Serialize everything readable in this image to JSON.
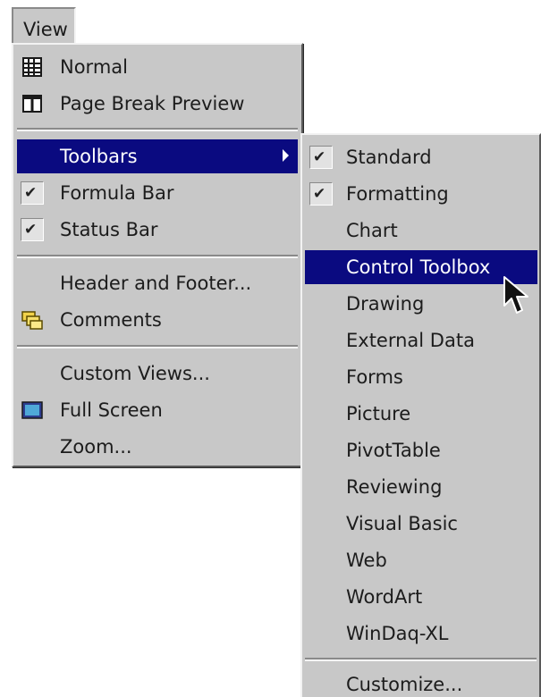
{
  "menubar": {
    "view_label": "View"
  },
  "view_menu": {
    "items": [
      {
        "label": "Normal",
        "icon": "normal-view-icon"
      },
      {
        "label": "Page Break Preview",
        "icon": "page-break-preview-icon"
      },
      {
        "label": "Toolbars",
        "highlighted": true,
        "has_submenu": true
      },
      {
        "label": "Formula Bar",
        "checked": true
      },
      {
        "label": "Status Bar",
        "checked": true
      },
      {
        "label": "Header and Footer..."
      },
      {
        "label": "Comments",
        "icon": "comments-icon"
      },
      {
        "label": "Custom Views..."
      },
      {
        "label": "Full Screen",
        "icon": "full-screen-icon"
      },
      {
        "label": "Zoom..."
      }
    ]
  },
  "toolbars_submenu": {
    "items": [
      {
        "label": "Standard",
        "checked": true
      },
      {
        "label": "Formatting",
        "checked": true
      },
      {
        "label": "Chart"
      },
      {
        "label": "Control Toolbox",
        "highlighted": true
      },
      {
        "label": "Drawing"
      },
      {
        "label": "External Data"
      },
      {
        "label": "Forms"
      },
      {
        "label": "Picture"
      },
      {
        "label": "PivotTable"
      },
      {
        "label": "Reviewing"
      },
      {
        "label": "Visual Basic"
      },
      {
        "label": "Web"
      },
      {
        "label": "WordArt"
      },
      {
        "label": "WinDaq-XL"
      },
      {
        "label": "Customize..."
      }
    ]
  },
  "colors": {
    "menu_bg": "#c8c8c8",
    "highlight_bg": "#0a0a80",
    "highlight_text": "#ffffff",
    "text": "#1c1c1c"
  }
}
